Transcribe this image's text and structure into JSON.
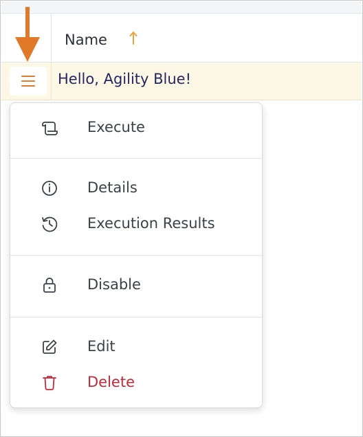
{
  "table": {
    "column_name": "Name",
    "sort_direction": "ascending",
    "rows": [
      {
        "name": "Hello, Agility Blue!"
      }
    ]
  },
  "context_menu": {
    "groups": [
      [
        {
          "label": "Execute",
          "icon": "script-icon"
        }
      ],
      [
        {
          "label": "Details",
          "icon": "info-icon"
        },
        {
          "label": "Execution Results",
          "icon": "history-icon"
        }
      ],
      [
        {
          "label": "Disable",
          "icon": "lock-icon"
        }
      ],
      [
        {
          "label": "Edit",
          "icon": "edit-icon"
        },
        {
          "label": "Delete",
          "icon": "trash-icon",
          "danger": true
        }
      ]
    ]
  },
  "colors": {
    "accent": "#e07a2a",
    "row_highlight": "#fdf8e6",
    "row_text": "#26265e",
    "danger": "#c3283b"
  }
}
